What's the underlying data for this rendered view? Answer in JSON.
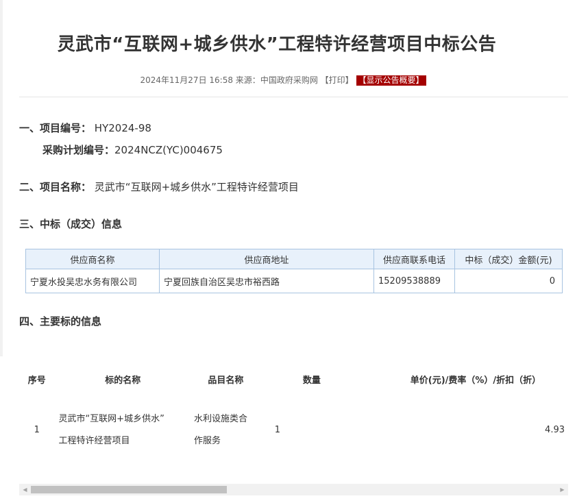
{
  "title": "灵武市“互联网+城乡供水”工程特许经营项目中标公告",
  "meta": {
    "datetime": "2024年11月27日 16:58",
    "source_label": "来源：",
    "source": "中国政府采购网",
    "print_label": "【打印】",
    "summary_label": "【显示公告概要】"
  },
  "section1": {
    "heading": "一、项目编号：",
    "value": "HY2024-98",
    "plan_label": "采购计划编号：",
    "plan_value": "2024NCZ(YC)004675"
  },
  "section2": {
    "heading": "二、项目名称：",
    "value": "灵武市“互联网+城乡供水”工程特许经营项目"
  },
  "section3": {
    "heading": "三、中标（成交）信息",
    "columns": [
      "供应商名称",
      "供应商地址",
      "供应商联系电话",
      "中标（成交）金额(元)"
    ],
    "rows": [
      [
        "宁夏水投吴忠水务有限公司",
        "宁夏回族自治区吴忠市裕西路",
        "15209538889",
        "0"
      ]
    ]
  },
  "section4": {
    "heading": "四、主要标的信息",
    "columns": [
      "序号",
      "标的名称",
      "品目名称",
      "数量",
      "单价(元)/费率（%）/折扣（折）"
    ],
    "rows": [
      {
        "index": "1",
        "name_line1": "灵武市“互联网+城乡供水”",
        "name_line2": "工程特许经营项目",
        "category_line1": "水利设施类合",
        "category_line2": "作服务",
        "quantity": "1",
        "price": "4.93"
      }
    ]
  },
  "icons": {
    "scroll_left": "scroll-left-arrow-icon",
    "scroll_right": "scroll-right-arrow-icon"
  },
  "colors": {
    "summary_bg": "#a40000",
    "table_header_bg": "#e8f1fb",
    "table_border": "#a7c3e0"
  }
}
